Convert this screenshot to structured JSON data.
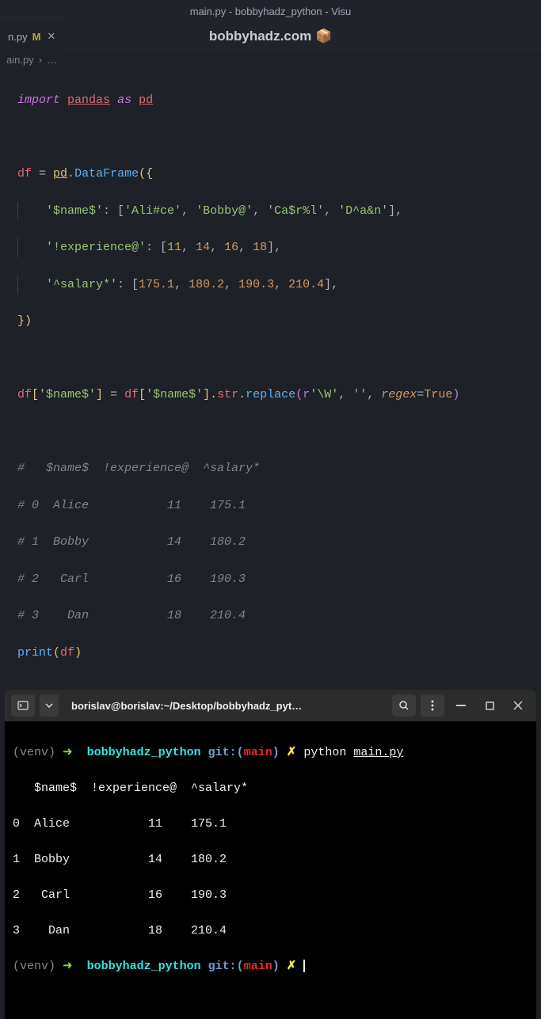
{
  "window_title": "main.py - bobbyhadz_python - Visu",
  "watermark": "bobbyhadz.com 📦",
  "tab": {
    "name": "n.py",
    "modified": "M"
  },
  "breadcrumb": {
    "file": "ain.py",
    "sep": "›",
    "more": "…"
  },
  "code": {
    "l1": {
      "import": "import",
      "pandas": "pandas",
      "as": "as",
      "pd": "pd"
    },
    "l3": {
      "df": "df",
      "eq": " = ",
      "pd": "pd",
      "dot": ".",
      "DataFrame": "DataFrame",
      "open": "({"
    },
    "l4": {
      "indent": "    ",
      "key": "'$name$'",
      "colon": ": [",
      "v1": "'Ali#ce'",
      "c": ", ",
      "v2": "'Bobby@'",
      "v3": "'Ca$r%l'",
      "v4": "'D^a&n'",
      "close": "],"
    },
    "l5": {
      "indent": "    ",
      "key": "'!experience@'",
      "colon": ": [",
      "v1": "11",
      "c": ", ",
      "v2": "14",
      "v3": "16",
      "v4": "18",
      "close": "],"
    },
    "l6": {
      "indent": "    ",
      "key": "'^salary*'",
      "colon": ": [",
      "v1": "175.1",
      "c": ", ",
      "v2": "180.2",
      "v3": "190.3",
      "v4": "210.4",
      "close": "],"
    },
    "l7": {
      "close": "})"
    },
    "l9": {
      "df": "df",
      "b1": "[",
      "k1": "'$name$'",
      "b2": "]",
      "eq": " = ",
      "df2": "df",
      "b3": "[",
      "k2": "'$name$'",
      "b4": "].",
      "str": "str",
      "dot": ".",
      "replace": "replace",
      "p1": "(",
      "r": "r",
      "pat": "'\\W'",
      "c1": ", ",
      "empty": "''",
      "c2": ", ",
      "regex": "regex",
      "eq2": "=",
      "true": "True",
      "p2": ")"
    },
    "c1": "#   $name$  !experience@  ^salary*",
    "c2": "# 0  Alice           11    175.1",
    "c3": "# 1  Bobby           14    180.2",
    "c4": "# 2   Carl           16    190.3",
    "c5": "# 3    Dan           18    210.4",
    "l16": {
      "print": "print",
      "p1": "(",
      "df": "df",
      "p2": ")"
    }
  },
  "terminal": {
    "title": "borislav@borislav:~/Desktop/bobbyhadz_pyt…",
    "prompt": {
      "venv": "(venv)",
      "arrow": "➜",
      "dir": "bobbyhadz_python",
      "git": "git:(",
      "branch": "main",
      "gitclose": ")",
      "dirty": "✗"
    },
    "cmd": {
      "python": "python",
      "file": "main.py"
    },
    "out": {
      "h": "   $name$  !experience@  ^salary*",
      "r0": "0  Alice           11    175.1",
      "r1": "1  Bobby           14    180.2",
      "r2": "2   Carl           16    190.3",
      "r3": "3    Dan           18    210.4"
    }
  }
}
